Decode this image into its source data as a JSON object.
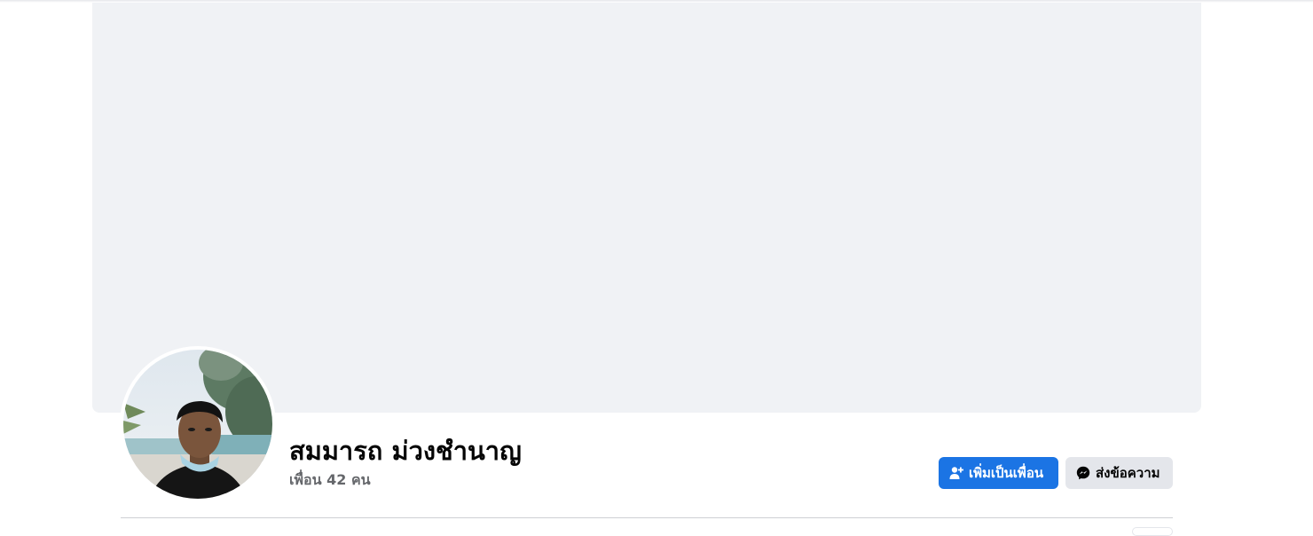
{
  "profile": {
    "name": "สมมารถ ม่วงชำนาญ",
    "friends_count": "เพื่อน 42 คน"
  },
  "actions": {
    "add_friend_label": "เพิ่มเป็นเพื่อน",
    "message_label": "ส่งข้อความ"
  },
  "icons": {
    "add_friend": "add-friend-icon",
    "messenger": "messenger-icon"
  },
  "colors": {
    "primary": "#1b74e4",
    "secondary_button": "#e4e6eb",
    "cover": "#f0f2f5",
    "text_secondary": "#65676b"
  }
}
